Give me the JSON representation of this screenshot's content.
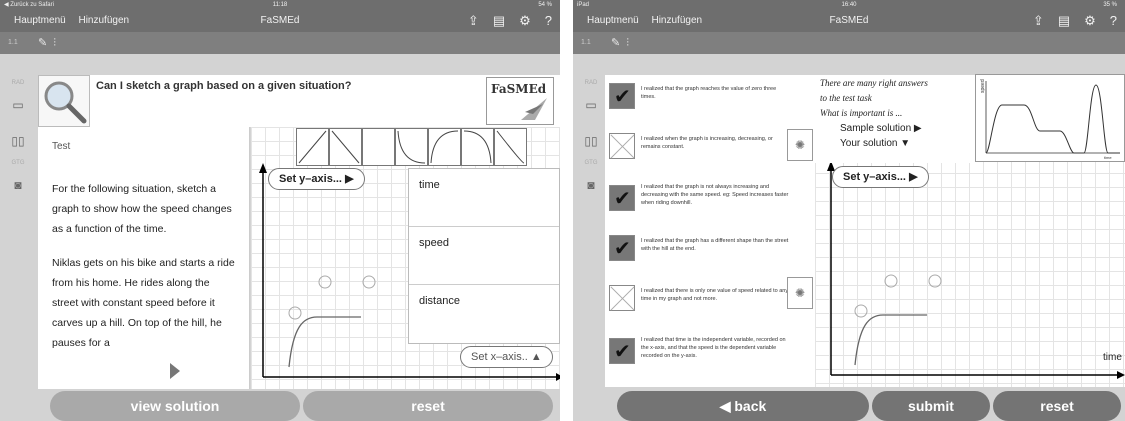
{
  "left": {
    "status": {
      "back": "◀ Zurück zu Safari",
      "time": "11:18",
      "battery": "54 %"
    },
    "nav": {
      "menu": "Hauptmenü",
      "add": "Hinzufügen",
      "title": "FaSMEd"
    },
    "toolbar": {
      "page": "1.1"
    },
    "sidebar": {
      "rad": "RAD",
      "gtg": "GTG"
    },
    "question": "Can I sketch a graph based on a given situation?",
    "logo": "FaSMEd",
    "test_title": "Test",
    "test_paragraph_1": "For the following situation, sketch a graph to show how the speed changes as a function of the time.",
    "test_paragraph_2": "Niklas gets on his bike and starts a ride from his home. He rides along the street with constant speed before it carves up a hill. On top of the hill, he pauses for a",
    "set_y_axis": "Set y–axis...",
    "set_x_axis": "Set x–axis..",
    "variables": [
      "time",
      "speed",
      "distance"
    ],
    "view_solution": "view solution",
    "reset": "reset"
  },
  "right": {
    "status": {
      "device": "iPad",
      "time": "16:40",
      "battery": "35 %"
    },
    "nav": {
      "menu": "Hauptmenü",
      "add": "Hinzufügen",
      "title": "FaSMEd"
    },
    "toolbar": {
      "page": "1.1"
    },
    "sidebar": {
      "rad": "RAD",
      "gtg": "GTG"
    },
    "checklist": [
      {
        "checked": true,
        "text": "I realized that the graph reaches the value of zero three times."
      },
      {
        "checked": false,
        "text": "I realized when the graph is increasing, decreasing, or remains constant.",
        "hint": true
      },
      {
        "checked": true,
        "text": "I realized that the graph is not always increasing and decreasing with the same speed. eg: Speed increases faster when riding downhill."
      },
      {
        "checked": true,
        "text": "I realized that the graph has a different shape than the street with the hill at the end."
      },
      {
        "checked": false,
        "text": "I realized that there is only one value of speed related to any time in my graph and not more.",
        "hint": true
      },
      {
        "checked": true,
        "text": "I realized that time is the independent variable, recorded on the x-axis, and that the speed is the dependent variable recorded on the y-axis."
      }
    ],
    "tip_1": "There are many right answers",
    "tip_2": "to the test task",
    "tip_3": "What is important is ...",
    "sample_solution": "Sample solution ▶",
    "your_solution": "Your solution ▼",
    "sample_y_label": "speed",
    "sample_x_label": "time",
    "set_y_axis": "Set y–axis...",
    "axis_time": "time",
    "back": "◀ back",
    "submit": "submit",
    "reset": "reset"
  }
}
